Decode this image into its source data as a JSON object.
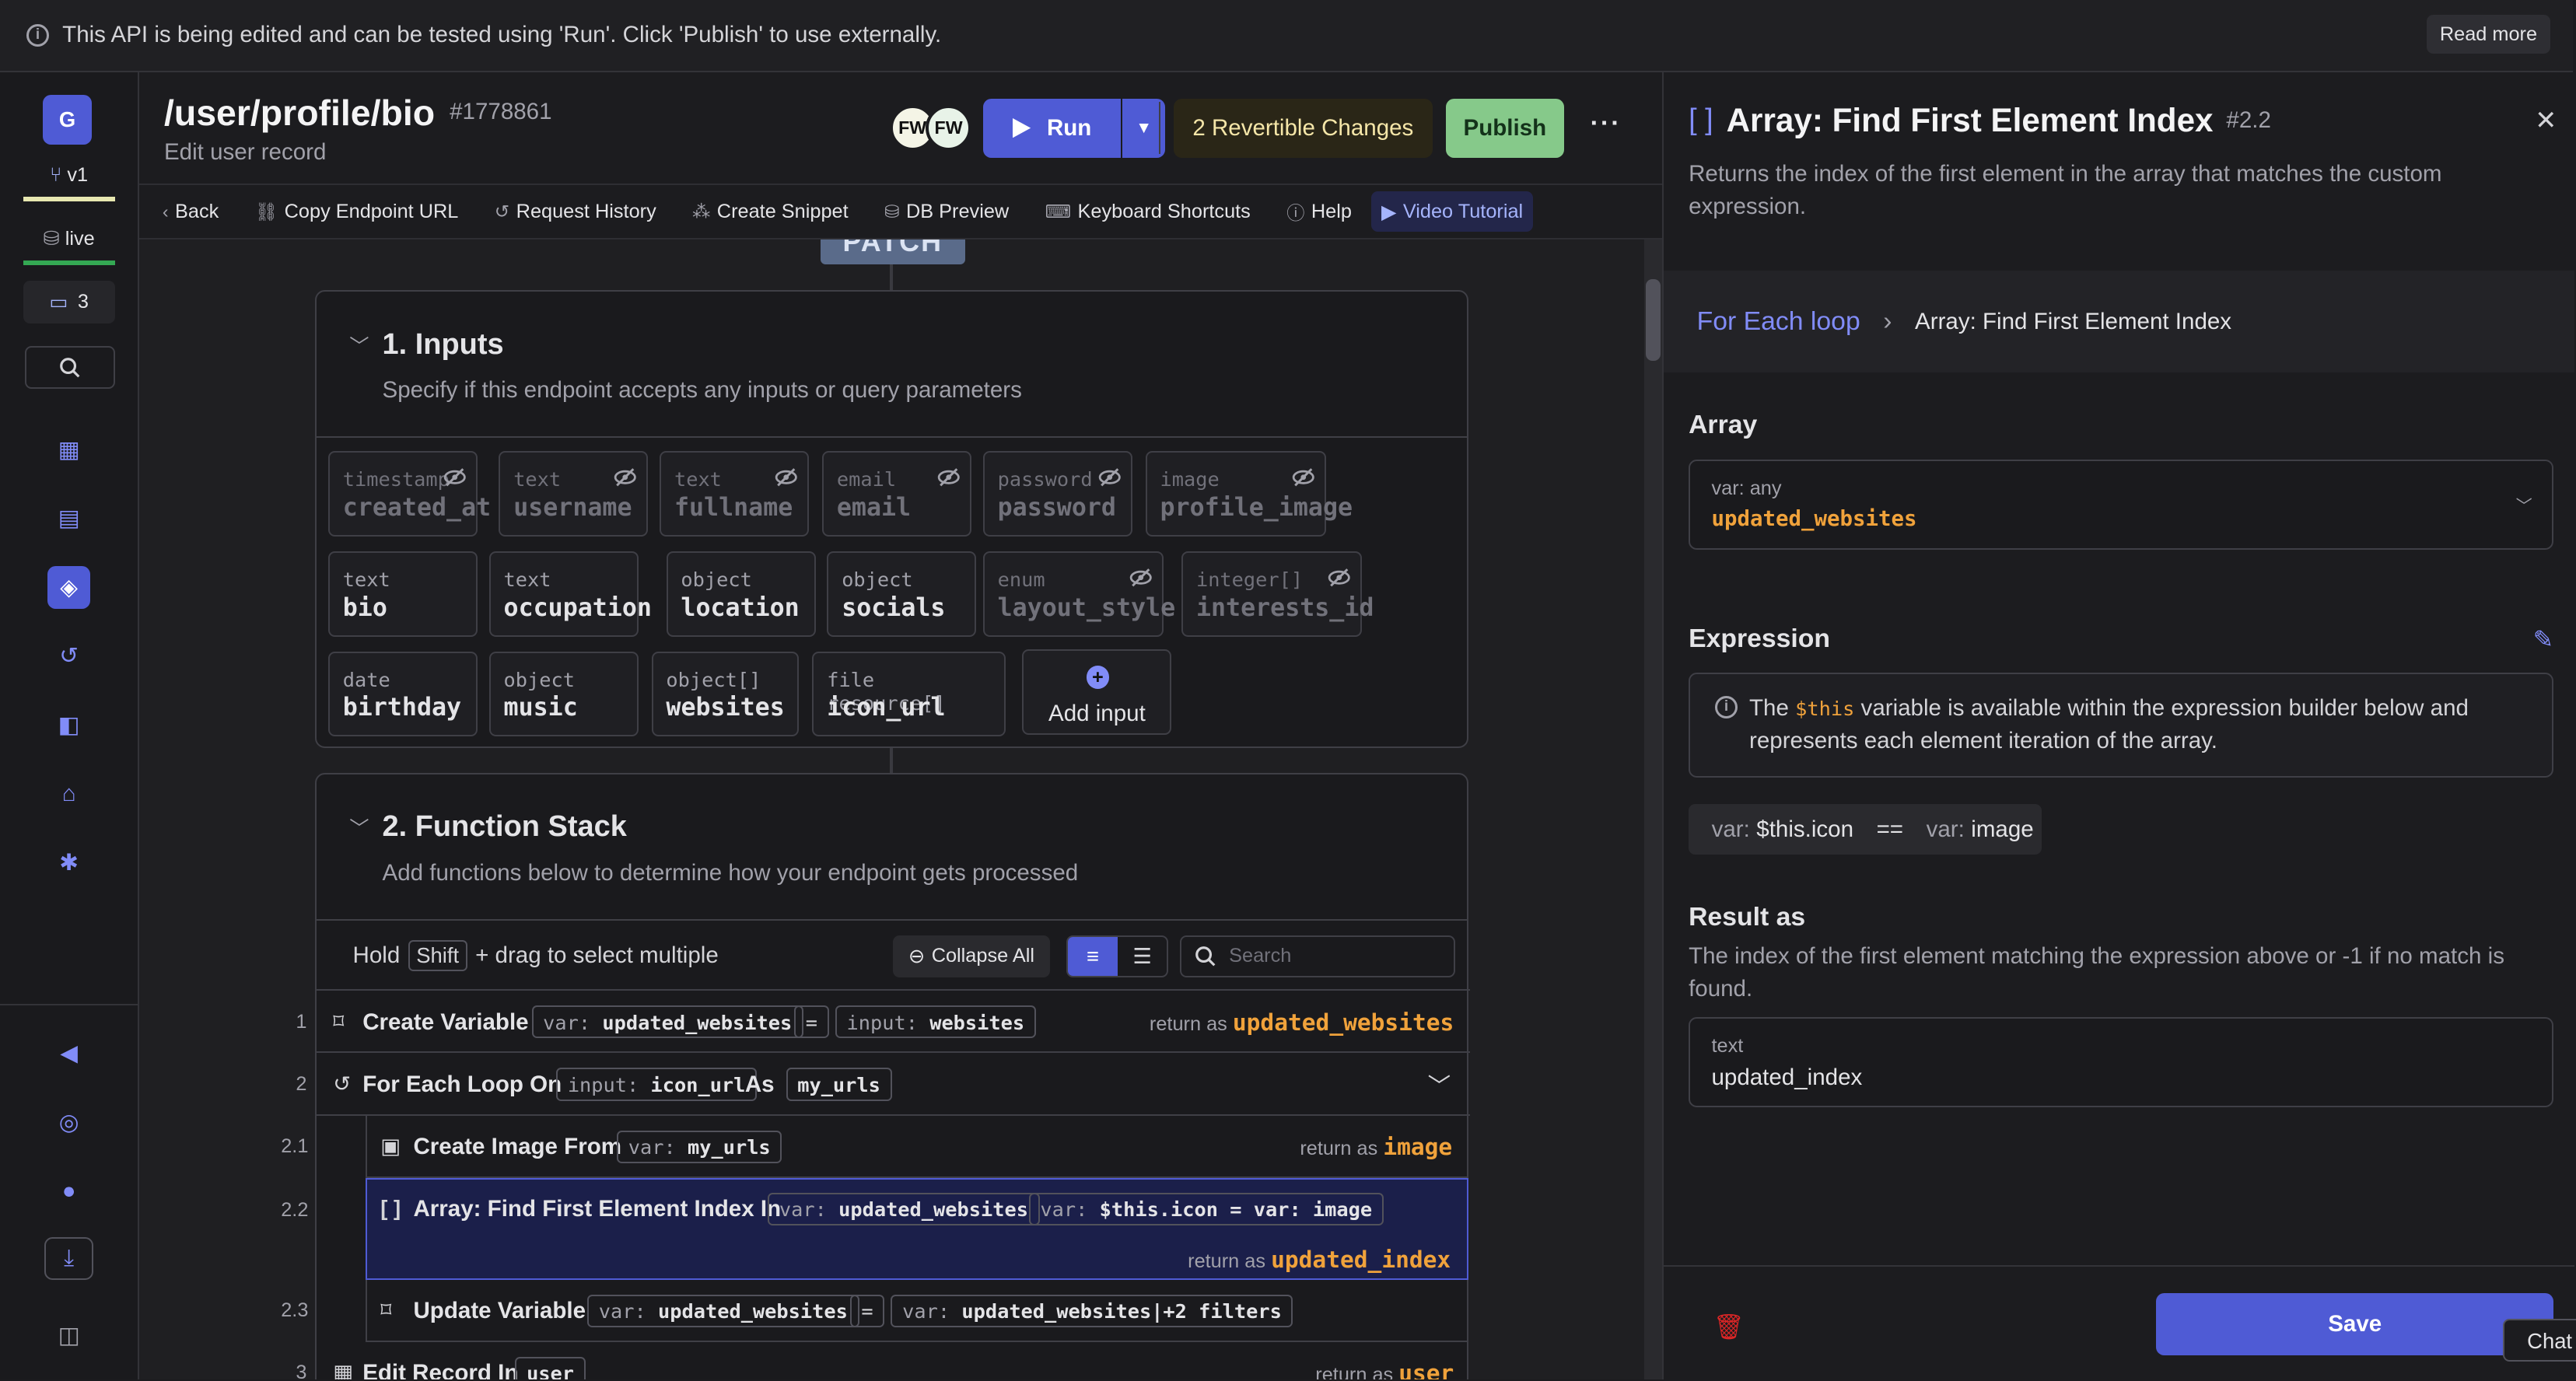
{
  "banner": {
    "text": "This API is being edited and can be tested using 'Run'. Click 'Publish' to use externally.",
    "read_more": "Read more"
  },
  "rail": {
    "workspace_initial": "G",
    "branch": "v1",
    "datasource": "live",
    "comment_count": "3"
  },
  "header": {
    "title": "/user/profile/bio",
    "id": "#1778861",
    "subtitle": "Edit user record",
    "avatars": [
      "FW",
      "FW"
    ],
    "run_label": "Run",
    "changes_label": "2 Revertible Changes",
    "publish_label": "Publish"
  },
  "toolbar": {
    "items": [
      "Back",
      "Copy Endpoint URL",
      "Request History",
      "Create Snippet",
      "DB Preview",
      "Keyboard Shortcuts",
      "Help",
      "Video Tutorial"
    ]
  },
  "canvas": {
    "method": "PATCH",
    "inputs_section": {
      "title": "1. Inputs",
      "description": "Specify if this endpoint accepts any inputs or query parameters",
      "add_label": "Add input",
      "inputs": [
        {
          "type": "timestamp",
          "name": "created_at",
          "hidden": true
        },
        {
          "type": "text",
          "name": "username",
          "hidden": true
        },
        {
          "type": "text",
          "name": "fullname",
          "hidden": true
        },
        {
          "type": "email",
          "name": "email",
          "hidden": true
        },
        {
          "type": "password",
          "name": "password",
          "hidden": true
        },
        {
          "type": "image",
          "name": "profile_image",
          "hidden": true
        },
        {
          "type": "text",
          "name": "bio",
          "hidden": false
        },
        {
          "type": "text",
          "name": "occupation",
          "hidden": false
        },
        {
          "type": "object",
          "name": "location",
          "hidden": false
        },
        {
          "type": "object",
          "name": "socials",
          "hidden": false
        },
        {
          "type": "enum",
          "name": "layout_style",
          "hidden": true
        },
        {
          "type": "integer[]",
          "name": "interests_id",
          "hidden": true
        },
        {
          "type": "date",
          "name": "birthday",
          "hidden": false
        },
        {
          "type": "object",
          "name": "music",
          "hidden": false
        },
        {
          "type": "object[]",
          "name": "websites",
          "hidden": false
        },
        {
          "type": "file resource[]",
          "name": "icon_url",
          "hidden": false
        }
      ]
    },
    "function_section": {
      "title": "2. Function Stack",
      "description": "Add functions below to determine how your endpoint gets processed",
      "hold_text": "Hold",
      "shift_key": "Shift",
      "drag_text": "+ drag to select multiple",
      "collapse_all": "Collapse All",
      "search_placeholder": "Search",
      "return_as": "return as",
      "rows": {
        "r1": {
          "num": "1",
          "label": "Create Variable",
          "p1_prefix": "var:",
          "p1": "updated_websites",
          "eq": "=",
          "p2_prefix": "input:",
          "p2": "websites",
          "ret": "updated_websites"
        },
        "r2": {
          "num": "2",
          "label": "For Each Loop On",
          "p1_prefix": "input:",
          "p1": "icon_url",
          "as": "As",
          "p2": "my_urls"
        },
        "r21": {
          "num": "2.1",
          "label": "Create Image From",
          "p1_prefix": "var:",
          "p1": "my_urls",
          "ret": "image"
        },
        "r22": {
          "num": "2.2",
          "label": "Array: Find First Element Index In",
          "p1_prefix": "var:",
          "p1": "updated_websites",
          "p2_prefix": "var:",
          "p2": "$this.icon = var: image",
          "ret": "updated_index"
        },
        "r23": {
          "num": "2.3",
          "label": "Update Variable",
          "p1_prefix": "var:",
          "p1": "updated_websites",
          "eq": "=",
          "p2_prefix": "var:",
          "p2": "updated_websites|+2 filters"
        },
        "r3": {
          "num": "3",
          "label": "Edit Record In",
          "p1": "user",
          "ret": "user"
        }
      }
    }
  },
  "panel": {
    "title": "Array: Find First Element Index",
    "index": "#2.2",
    "description": "Returns the index of the first element in the array that matches the custom expression.",
    "breadcrumb": [
      "For Each loop",
      "Array: Find First Element Index"
    ],
    "array_label": "Array",
    "array_type": "var: any",
    "array_value": "updated_websites",
    "expression_label": "Expression",
    "note_before": "The",
    "note_var": "$this",
    "note_after": "variable is available within the expression builder below and represents each element iteration of the array.",
    "expr_left_prefix": "var:",
    "expr_left": "$this.icon",
    "expr_op": "==",
    "expr_right_prefix": "var:",
    "expr_right": "image",
    "result_label": "Result as",
    "result_desc": "The index of the first element matching the expression above or -1 if no match is found.",
    "result_type": "text",
    "result_value": "updated_index",
    "save_label": "Save",
    "chat_label": "Chat"
  }
}
